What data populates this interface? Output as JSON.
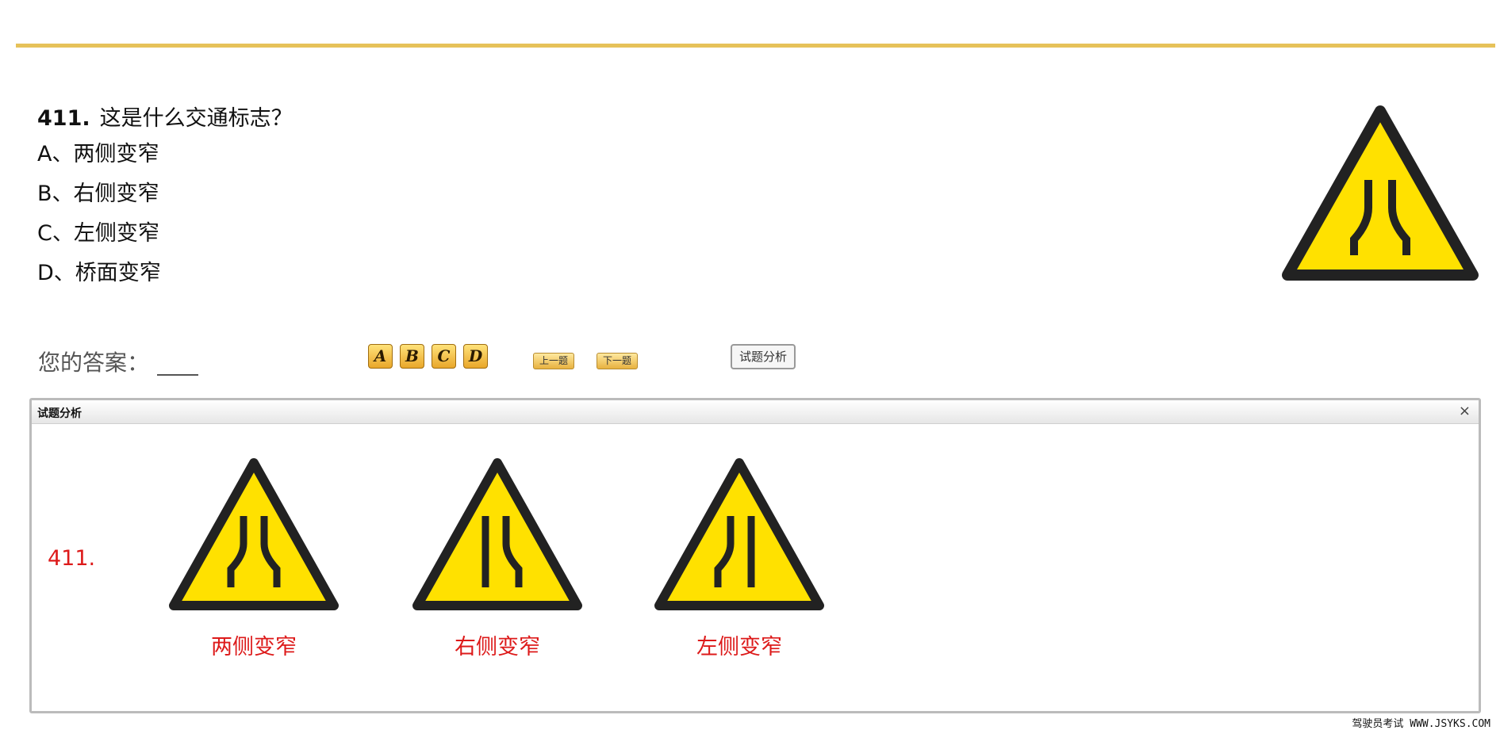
{
  "question": {
    "number": "411.",
    "text": "这是什么交通标志？",
    "options": [
      "A、两侧变窄",
      "B、右侧变窄",
      "C、左侧变窄",
      "D、桥面变窄"
    ]
  },
  "answer": {
    "label": "您的答案："
  },
  "buttons": {
    "letters": [
      "A",
      "B",
      "C",
      "D"
    ],
    "prev": "上一题",
    "next": "下一题",
    "analysis": "试题分析"
  },
  "analysis_panel": {
    "title": "试题分析",
    "close": "×",
    "number": "411.",
    "signs": [
      {
        "caption": "两侧变窄",
        "icon": "road-narrows-both-sides-icon"
      },
      {
        "caption": "右侧变窄",
        "icon": "road-narrows-right-icon"
      },
      {
        "caption": "左侧变窄",
        "icon": "road-narrows-left-icon"
      }
    ]
  },
  "footer": {
    "text": "驾驶员考试 WWW.JSYKS.COM"
  },
  "colors": {
    "accent": "#e6c25a",
    "sign_yellow": "#ffe100",
    "sign_border": "#222222",
    "red_text": "#dd1a1a"
  }
}
